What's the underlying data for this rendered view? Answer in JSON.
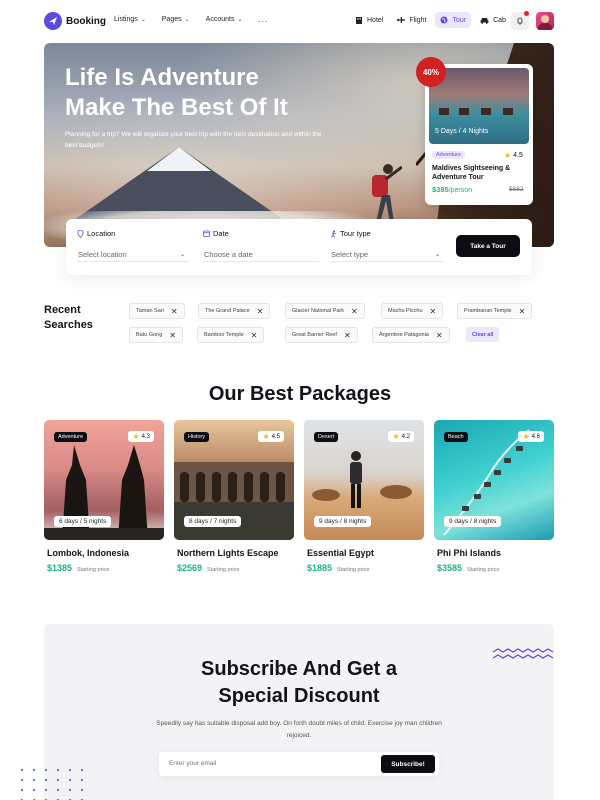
{
  "nav": {
    "brand": "Booking",
    "menu": [
      {
        "label": "Listings"
      },
      {
        "label": "Pages"
      },
      {
        "label": "Accounts"
      }
    ],
    "more": "...",
    "modes": [
      {
        "label": "Hotel",
        "icon": "hotel-icon",
        "active": false
      },
      {
        "label": "Flight",
        "icon": "plane-icon",
        "active": false
      },
      {
        "label": "Tour",
        "icon": "globe-icon",
        "active": true
      },
      {
        "label": "Cab",
        "icon": "car-icon",
        "active": false
      }
    ],
    "notification_icon": "bell-icon",
    "accent": "#5b4ce0"
  },
  "hero": {
    "title_line1": "Life Is Adventure",
    "title_line2": "Make The Best Of It",
    "subtitle": "Planning for a trip? We will organize your best trip with the best destination and within the best budgets!"
  },
  "featured": {
    "discount": "40%",
    "duration": "5 Days / 4 Nights",
    "category": "Adventure",
    "rating": "4.5",
    "title": "Maldives Sightseeing & Adventure Tour",
    "price": "$385",
    "price_unit": "/person",
    "old_price": "$682"
  },
  "search": {
    "location": {
      "label": "Location",
      "placeholder": "Select location"
    },
    "date": {
      "label": "Date",
      "placeholder": "Choose a date"
    },
    "tour_type": {
      "label": "Tour type",
      "placeholder": "Select type"
    },
    "submit": "Take a Tour"
  },
  "recent": {
    "title": "Recent Searches",
    "tags": [
      "Taman Sari",
      "The Grand Palace",
      "Glacier National Park",
      "Machu Picchu",
      "Prambanan Temple",
      "Batu Gong",
      "Bamboo Temple",
      "Great Barrier Reef",
      "Argentine Patagonia"
    ],
    "clear_label": "Clear all"
  },
  "packages": {
    "title": "Our Best Packages",
    "starting_label": "Starting price",
    "items": [
      {
        "category": "Adventure",
        "rating": "4.3",
        "duration": "6 days / 5 nights",
        "name": "Lombok, Indonesia",
        "price": "$1385"
      },
      {
        "category": "History",
        "rating": "4.5",
        "duration": "8 days / 7 nights",
        "name": "Northern Lights Escape",
        "price": "$2569"
      },
      {
        "category": "Desert",
        "rating": "4.2",
        "duration": "9 days / 8 nights",
        "name": "Essential Egypt",
        "price": "$1885"
      },
      {
        "category": "Beach",
        "rating": "4.6",
        "duration": "9 days / 8 nights",
        "name": "Phi Phi Islands",
        "price": "$3585"
      }
    ]
  },
  "subscribe": {
    "title_line1": "Subscribe And Get a",
    "title_line2": "Special Discount",
    "text": "Speedily say has suitable disposal add boy. On forth doubt miles of child. Exercise joy man children rejoiced.",
    "placeholder": "Enter your email",
    "button": "Subscribe!"
  }
}
